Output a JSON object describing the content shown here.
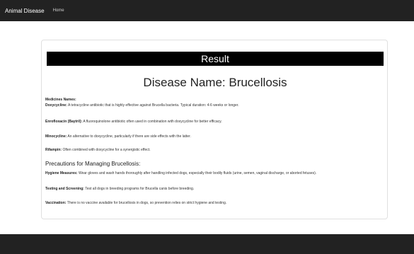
{
  "navbar": {
    "brand": "Animal Disease",
    "home": "Home"
  },
  "card": {
    "result_heading": "Result",
    "disease_name": "Disease Name: Brucellosis",
    "medicines_label": "Medicines Names:",
    "medicines": [
      {
        "name": "Doxycycline:",
        "desc": "A tetracycline antibiotic that is highly effective against Brucella bacteria. Typical duration: 4-6 weeks or longer."
      },
      {
        "name": "Enrofloxacin (Baytril):",
        "desc": "A fluoroquinolone antibiotic often used in combination with doxycycline for better efficacy."
      },
      {
        "name": "Minocycline:",
        "desc": "An alternative to doxycycline, particularly if there are side effects with the latter."
      },
      {
        "name": "Rifampin:",
        "desc": "Often combined with doxycycline for a synergistic effect."
      }
    ],
    "precautions_title": "Precautions for Managing Brucellosis:",
    "precautions": [
      {
        "name": "Hygiene Measures:",
        "desc": "Wear gloves and wash hands thoroughly after handling infected dogs, especially their bodily fluids (urine, semen, vaginal discharge, or aborted fetuses)."
      },
      {
        "name": "Testing and Screening:",
        "desc": "Test all dogs in breeding programs for Brucella canis before breeding."
      },
      {
        "name": "Vaccination:",
        "desc": "There is no vaccine available for brucellosis in dogs, so prevention relies on strict hygiene and testing."
      }
    ]
  }
}
